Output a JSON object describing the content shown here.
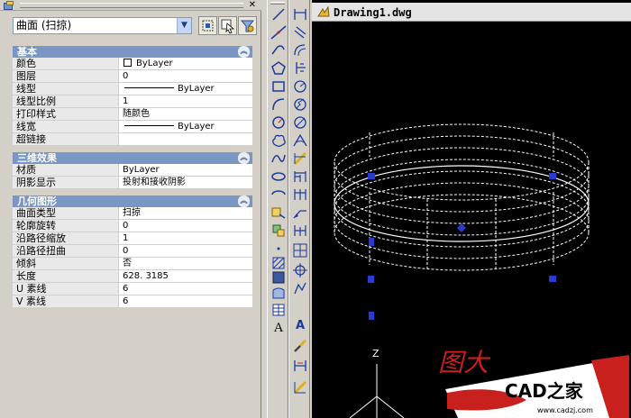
{
  "window": {
    "drawing_title": "Drawing1.dwg"
  },
  "properties_panel": {
    "object_type": "曲面 (扫掠)",
    "sections": [
      {
        "title": "基本",
        "rows": [
          {
            "key": "颜色",
            "value": "ByLayer",
            "glyph": "box"
          },
          {
            "key": "图层",
            "value": "0"
          },
          {
            "key": "线型",
            "value": "ByLayer",
            "glyph": "line"
          },
          {
            "key": "线型比例",
            "value": "1"
          },
          {
            "key": "打印样式",
            "value": "随颜色"
          },
          {
            "key": "线宽",
            "value": "ByLayer",
            "glyph": "line"
          },
          {
            "key": "超链接",
            "value": ""
          }
        ]
      },
      {
        "title": "三维效果",
        "rows": [
          {
            "key": "材质",
            "value": "ByLayer"
          },
          {
            "key": "阴影显示",
            "value": "投射和接收阴影"
          }
        ]
      },
      {
        "title": "几何图形",
        "rows": [
          {
            "key": "曲面类型",
            "value": "扫掠"
          },
          {
            "key": "轮廓旋转",
            "value": "0"
          },
          {
            "key": "沿路径缩放",
            "value": "1"
          },
          {
            "key": "沿路径扭曲",
            "value": "0"
          },
          {
            "key": "倾斜",
            "value": "否"
          },
          {
            "key": "长度",
            "value": "628. 3185"
          },
          {
            "key": "U 素线",
            "value": "6"
          },
          {
            "key": "V 素线",
            "value": "6"
          }
        ]
      }
    ]
  },
  "toolbar_left": [
    "line-icon",
    "construction-line-icon",
    "polyline-icon",
    "polygon-icon",
    "rectangle-icon",
    "arc-icon",
    "circle-icon",
    "revision-cloud-icon",
    "spline-icon",
    "ellipse-icon",
    "ellipse-arc-icon",
    "insert-block-icon",
    "make-block-icon",
    "point-icon",
    "hatch-icon",
    "gradient-icon",
    "region-icon",
    "table-icon",
    "multiline-text-icon"
  ],
  "toolbar_right": [
    "linear-dimension-icon",
    "aligned-dimension-icon",
    "arc-length-icon",
    "ordinate-icon",
    "radius-icon",
    "jogged-icon",
    "diameter-icon",
    "angular-icon",
    "quick-dimension-icon",
    "baseline-icon",
    "continue-icon",
    "qleader-icon",
    "tolerance-icon",
    "center-mark-icon",
    "dim-edit-icon",
    "dim-text-edit-icon",
    "dim-update-icon",
    "dim-style-icon",
    "dim-override-icon"
  ],
  "canvas": {
    "axis_z_label": "Z",
    "overlay_text": "图大",
    "logo_text": "CAD之家",
    "logo_url": "www.cadzj.com"
  },
  "colors": {
    "section_header": "#7a96c4",
    "grip": "#2a3cd0",
    "logo_red": "#c8201c"
  }
}
